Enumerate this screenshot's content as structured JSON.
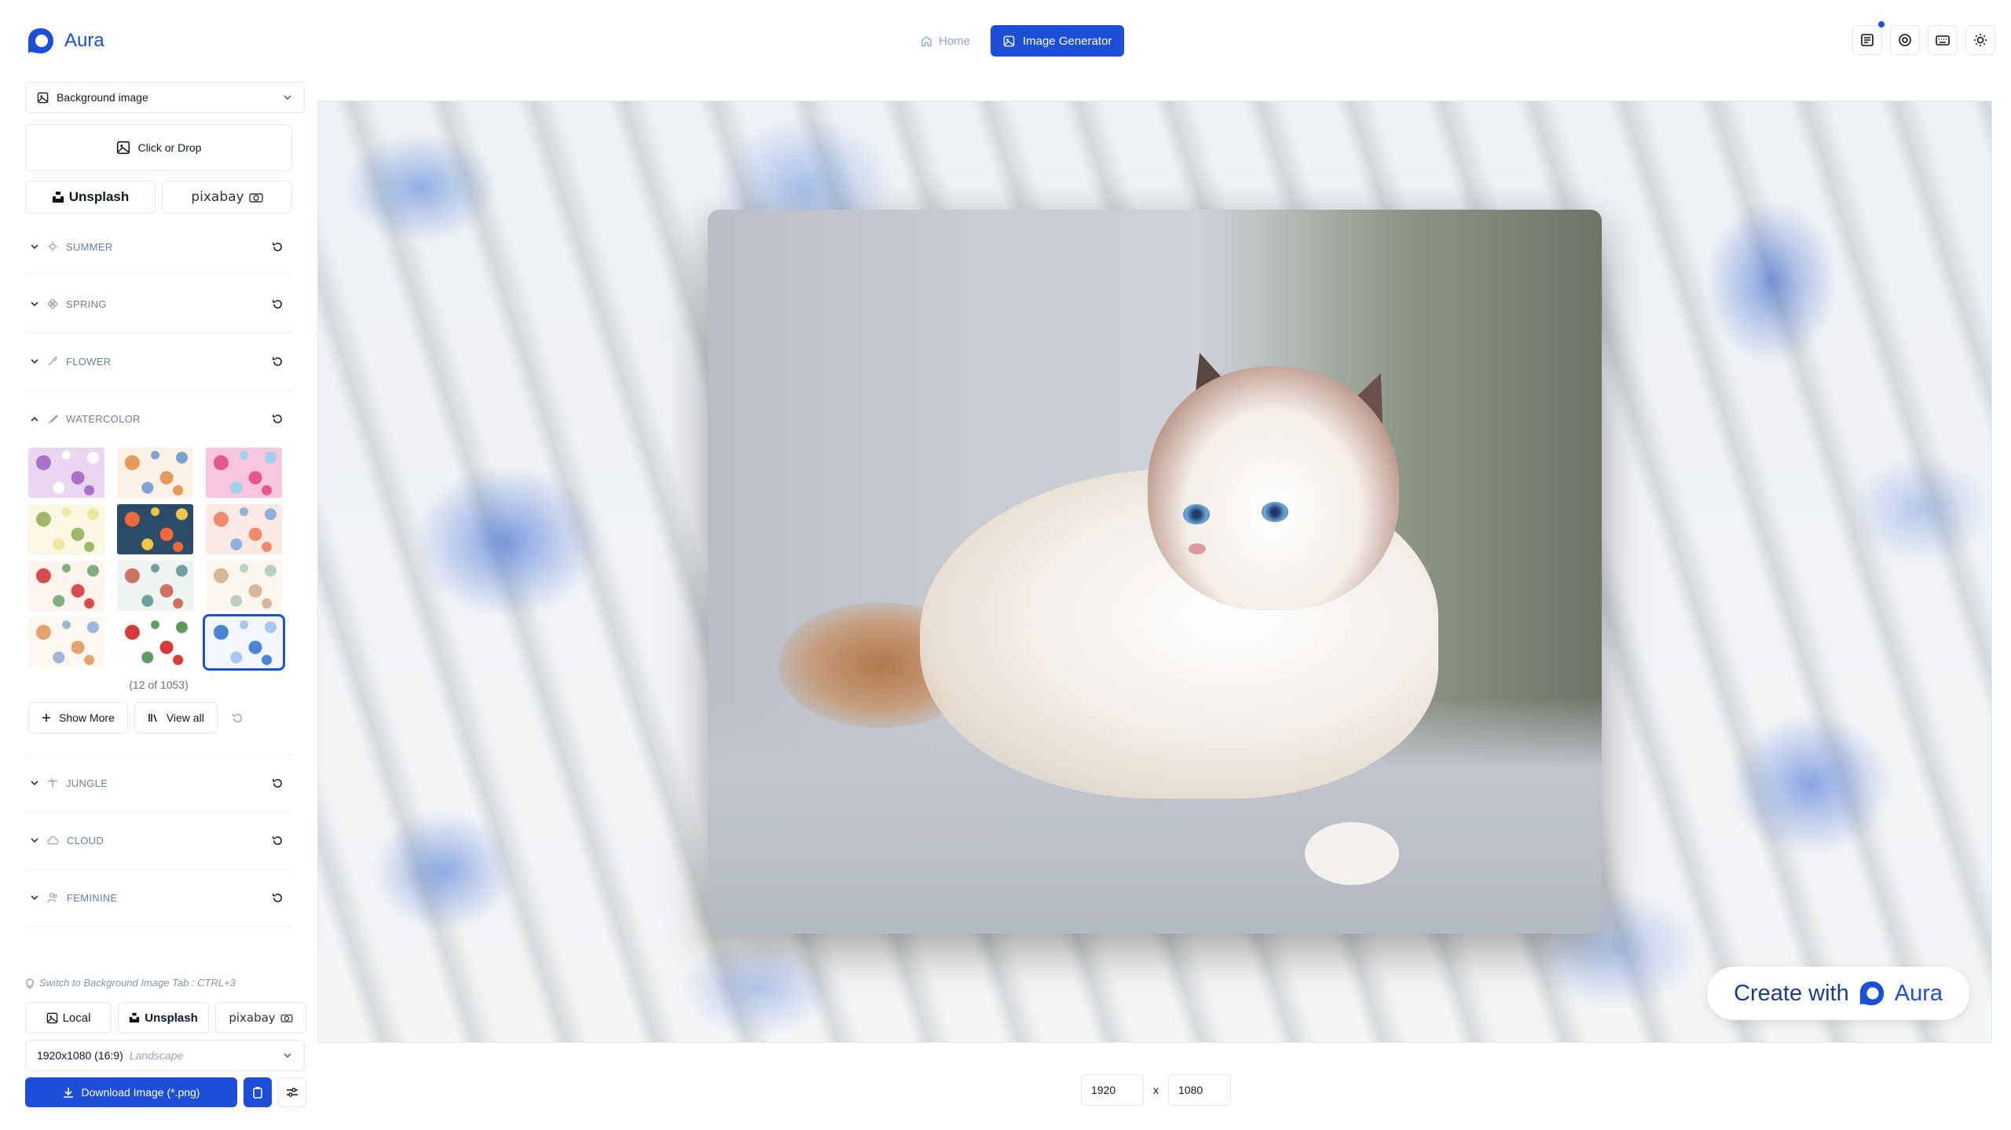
{
  "app": {
    "name": "Aura"
  },
  "nav": {
    "home": "Home",
    "generator": "Image Generator"
  },
  "top_icons": [
    "news-icon",
    "help-icon",
    "keyboard-icon",
    "sun-icon"
  ],
  "sidebar": {
    "mode_select": "Background image",
    "dropzone": "Click or Drop",
    "sources": {
      "unsplash": "Unsplash",
      "pixabay": "pixabay"
    },
    "categories_top": [
      {
        "label": "SUMMER",
        "icon": "sun-flower-icon"
      },
      {
        "label": "SPRING",
        "icon": "blossom-icon"
      },
      {
        "label": "FLOWER",
        "icon": "flower-icon"
      }
    ],
    "open_category": {
      "label": "WATERCOLOR",
      "icon": "brush-icon"
    },
    "thumbnails": [
      {
        "colors": [
          "#e9d7f2",
          "#a972c9",
          "#ffffff"
        ]
      },
      {
        "colors": [
          "#fbf1e6",
          "#e39a5c",
          "#7aa3d0"
        ]
      },
      {
        "colors": [
          "#f7c6de",
          "#e2588f",
          "#9bd3e8"
        ]
      },
      {
        "colors": [
          "#fbf7e3",
          "#9db86b",
          "#f0e6a0"
        ]
      },
      {
        "colors": [
          "#2a4b6a",
          "#f06a3a",
          "#f4c542"
        ]
      },
      {
        "colors": [
          "#fbe9e3",
          "#f08a6b",
          "#8fb0d8"
        ]
      },
      {
        "colors": [
          "#fdf3ef",
          "#d94a4a",
          "#7fae7f"
        ]
      },
      {
        "colors": [
          "#eef4f0",
          "#d07060",
          "#6ea0a0"
        ]
      },
      {
        "colors": [
          "#fbf6ee",
          "#d7b79a",
          "#b9d0c4"
        ]
      },
      {
        "colors": [
          "#fcf7f0",
          "#e4a36e",
          "#9fb6d6"
        ]
      },
      {
        "colors": [
          "#ffffff",
          "#d63a3a",
          "#5e9b5e"
        ]
      },
      {
        "colors": [
          "#f3f7fd",
          "#4a84d6",
          "#a9c6ef"
        ]
      }
    ],
    "count_text": "(12 of 1053)",
    "show_more": "Show More",
    "view_all": "View all",
    "categories_bottom": [
      {
        "label": "JUNGLE",
        "icon": "palm-icon"
      },
      {
        "label": "CLOUD",
        "icon": "cloud-icon"
      },
      {
        "label": "FEMININE",
        "icon": "users-icon"
      }
    ],
    "hint": "Switch to Background Image Tab : CTRL+3",
    "source_row": {
      "local": "Local",
      "unsplash": "Unsplash",
      "pixabay": "pixabay"
    },
    "ratio": {
      "value": "1920x1080 (16:9)",
      "orientation": "Landscape"
    },
    "download": "Download Image (*.png)"
  },
  "canvas": {
    "badge_prefix": "Create with",
    "badge_brand": "Aura"
  },
  "dims": {
    "width": "1920",
    "sep": "x",
    "height": "1080"
  },
  "colors": {
    "accent": "#1d4ed8",
    "muted_label": "#6b7f9f"
  }
}
